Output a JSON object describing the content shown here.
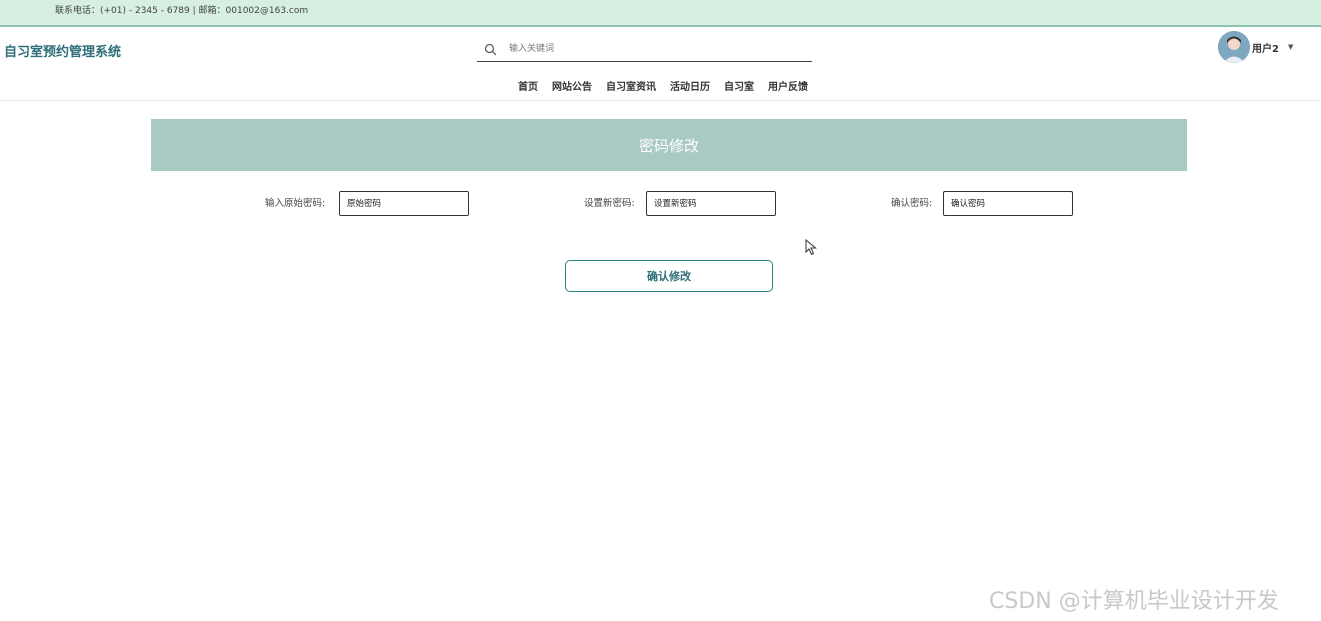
{
  "topbar": {
    "contact": "联系电话：(+01) - 2345 - 6789 | 邮箱：001002@163.com"
  },
  "header": {
    "site_title": "自习室预约管理系统",
    "search_placeholder": "输入关键词",
    "nav": [
      "首页",
      "网站公告",
      "自习室资讯",
      "活动日历",
      "自习室",
      "用户反馈"
    ],
    "user_name": "用户2",
    "caret": "▼"
  },
  "page": {
    "title": "密码修改",
    "fields": [
      {
        "label": "输入原始密码:",
        "placeholder": "原始密码"
      },
      {
        "label": "设置新密码:",
        "placeholder": "设置新密码"
      },
      {
        "label": "确认密码:",
        "placeholder": "确认密码"
      }
    ],
    "submit_label": "确认修改"
  },
  "watermark": "CSDN @计算机毕业设计开发",
  "colors": {
    "topbar_bg": "#d6efe1",
    "title_color": "#2d6e78",
    "banner_bg": "#a9c9c3",
    "button_border": "#2f7f86"
  }
}
